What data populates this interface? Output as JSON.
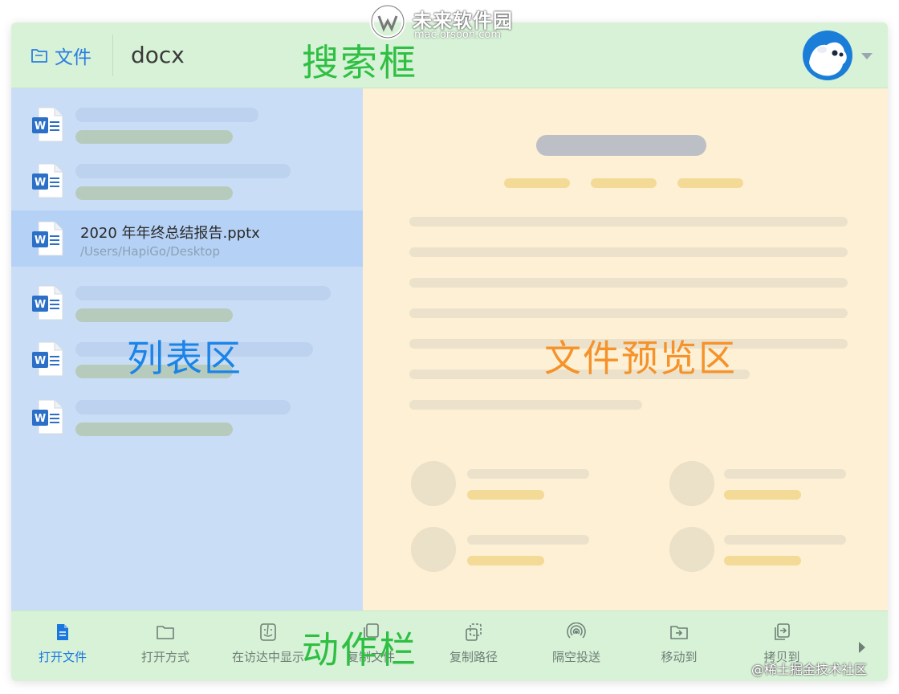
{
  "search_bar": {
    "scope_label": "文件",
    "query": "docx",
    "overlay_label": "搜索框"
  },
  "list": {
    "overlay_label": "列表区",
    "selected_item": {
      "name": "2020 年年终总结报告.pptx",
      "path": "/Users/HapiGo/Desktop"
    }
  },
  "preview": {
    "overlay_label": "文件预览区"
  },
  "action_bar": {
    "overlay_label": "动作栏",
    "actions": [
      {
        "label": "打开文件",
        "icon": "document-icon"
      },
      {
        "label": "打开方式",
        "icon": "folder-icon"
      },
      {
        "label": "在访达中显示",
        "icon": "finder-icon"
      },
      {
        "label": "复制文件",
        "icon": "copy-file-icon"
      },
      {
        "label": "复制路径",
        "icon": "copy-path-icon"
      },
      {
        "label": "隔空投送",
        "icon": "airdrop-icon"
      },
      {
        "label": "移动到",
        "icon": "move-folder-icon"
      },
      {
        "label": "拷贝到",
        "icon": "copy-to-icon"
      }
    ]
  },
  "watermarks": {
    "site_name": "未来软件园",
    "site_url": "mac.orsoon.com",
    "credit": "@稀土掘金技术社区"
  },
  "colors": {
    "accent_blue": "#1a77e0",
    "search_bar_bg": "#d7f2d7",
    "list_bg": "#c9def6",
    "preview_bg": "#fdf0d4",
    "label_green": "#2fbf43",
    "label_blue": "#1a84e8",
    "label_orange": "#f5922a"
  }
}
